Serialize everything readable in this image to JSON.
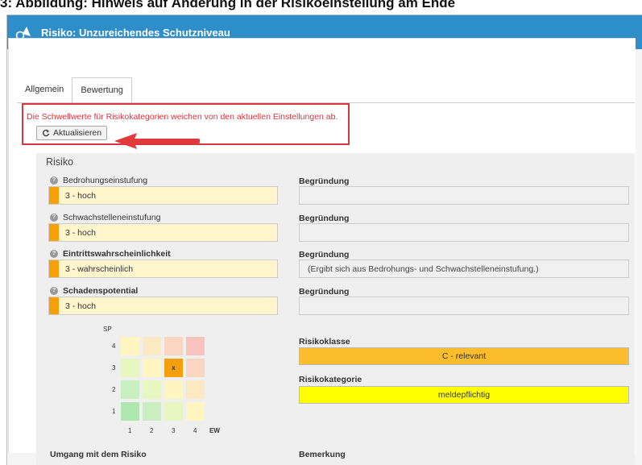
{
  "caption": "3: Abbildung: Hinweis auf Änderung in der Risikoeinstellung am Ende",
  "window": {
    "title": "Risiko: Unzureichendes Schutzniveau",
    "accent": "#2e8ec9"
  },
  "tabs": [
    {
      "label": "Allgemein"
    },
    {
      "label": "Bewertung"
    }
  ],
  "notice": {
    "text": "Die Schwellwerte für Risikokategorien weichen von den aktuellen Einstellungen ab.",
    "button": "Aktualisieren",
    "color": "#d9363e"
  },
  "panel": {
    "title": "Risiko"
  },
  "fields": [
    {
      "label": "Bedrohungseinstufung",
      "value": "3 - hoch",
      "reason_label": "Begründung",
      "reason": ""
    },
    {
      "label": "Schwachstelleneinstufung",
      "value": "3 - hoch",
      "reason_label": "Begründung",
      "reason": ""
    },
    {
      "label": "Eintrittswahrscheinlichkeit",
      "value": "3 - wahrscheinlich",
      "reason_label": "Begründung",
      "reason": "(Ergibt sich aus Bedrohungs- und Schwachstelleneinstufung.)"
    },
    {
      "label": "Schadenspotential",
      "value": "3 - hoch",
      "reason_label": "Begründung",
      "reason": ""
    }
  ],
  "matrix": {
    "y_label": "SP",
    "x_label": "EW",
    "y_ticks": [
      "4",
      "3",
      "2",
      "1"
    ],
    "x_ticks": [
      "1",
      "2",
      "3",
      "4"
    ],
    "marker": "x",
    "colors": [
      [
        "#fff5c0",
        "#fce9c2",
        "#fad6c0",
        "#f8c3bc"
      ],
      [
        "#e8f7c0",
        "#fff5c0",
        "#f5a00a",
        "#fad6c0"
      ],
      [
        "#c7efc0",
        "#e8f7c0",
        "#fff5c0",
        "#fce9c2"
      ],
      [
        "#aee8b0",
        "#c7efc0",
        "#e8f7c0",
        "#fff5c0"
      ]
    ]
  },
  "risk_class": {
    "label": "Risikoklasse",
    "value": "C - relevant",
    "color": "#fbbd2b"
  },
  "risk_category": {
    "label": "Risikokategorie",
    "value": "meldepflichtig",
    "color": "#ffff00"
  },
  "handling": {
    "label": "Umgang mit dem Risiko"
  },
  "remark": {
    "label": "Bemerkung"
  }
}
